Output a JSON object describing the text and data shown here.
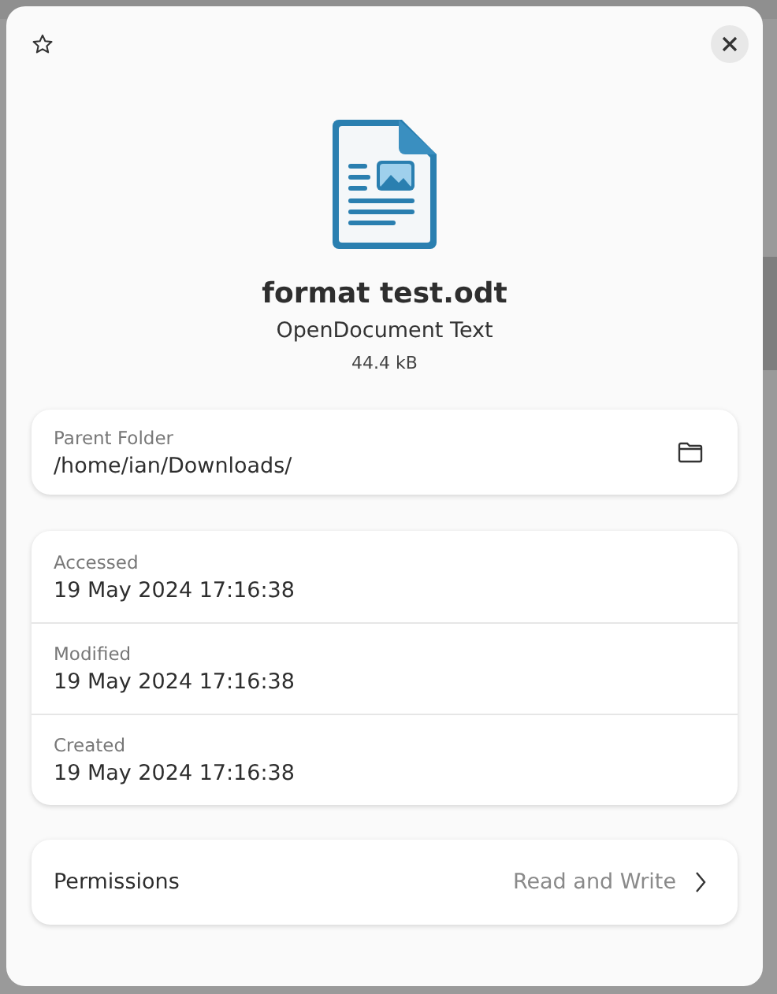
{
  "dialog": {
    "starred": false,
    "file_name": "format test.odt",
    "file_type": "OpenDocument Text",
    "file_size": "44.4 kB"
  },
  "parent_folder": {
    "label": "Parent Folder",
    "value": "/home/ian/Downloads/"
  },
  "dates": [
    {
      "label": "Accessed",
      "value": "19 May 2024 17:16:38"
    },
    {
      "label": "Modified",
      "value": "19 May 2024 17:16:38"
    },
    {
      "label": "Created",
      "value": "19 May 2024 17:16:38"
    }
  ],
  "permissions": {
    "label": "Permissions",
    "value": "Read and Write"
  }
}
